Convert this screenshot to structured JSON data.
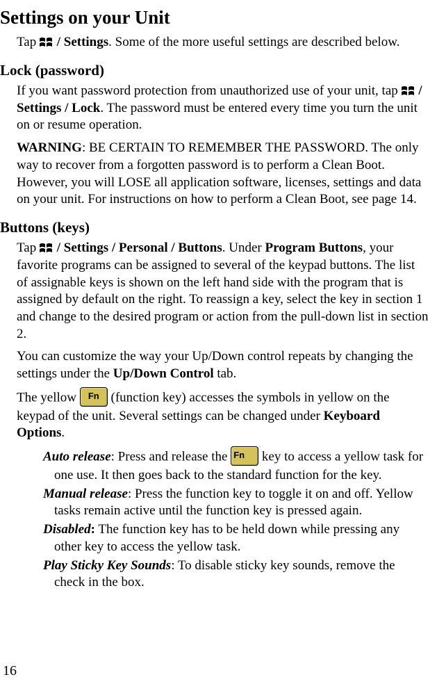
{
  "title": "Settings on your Unit",
  "intro": {
    "tap": "Tap ",
    "settings_path": " / Settings",
    "rest": ". Some of the more useful settings are described below."
  },
  "lock": {
    "heading": "Lock (password)",
    "para1_a": "If you want password protection from unauthorized use of your unit, tap ",
    "para1_path": " / Settings / Lock",
    "para1_b": ". The password must be entered every time you turn the unit on or resume operation.",
    "warning_label": "WARNING",
    "warning_text": ": BE CERTAIN TO REMEMBER THE PASSWORD. The only way to recover from a forgotten password is to perform a Clean Boot. However, you will LOSE all application software, licenses, settings and data on your unit. For instructions on how to perform a Clean Boot, see page 14."
  },
  "buttons": {
    "heading": "Buttons (keys)",
    "para1_a": "Tap ",
    "para1_path": " / Settings / Personal / Buttons",
    "para1_b": ". Under ",
    "para1_c": "Program Buttons",
    "para1_d": ", your favorite programs can be assigned to several of the keypad buttons. The list of assignable keys is shown on the left hand side with the program that is assigned by default on the right. To reassign a key, select the key in section 1 and change to the desired program or action from the pull-down list in section 2.",
    "para2_a": "You can customize the way your Up/Down control repeats by changing the settings under the ",
    "para2_b": "Up/Down Control",
    "para2_c": " tab.",
    "para3_a": "The yellow ",
    "para3_b": " (function key) accesses the symbols in yellow on the keypad of the unit. Several settings can be changed under ",
    "para3_c": "Keyboard Options",
    "para3_d": ".",
    "options": {
      "auto": {
        "label": "Auto release",
        "text_a": ": Press and release the ",
        "text_b": " key to access a yellow task for one use. It then goes back to the standard function for the key."
      },
      "manual": {
        "label": "Manual release",
        "text": ": Press the function key to toggle it on and off. Yellow tasks remain active until the function key is pressed again."
      },
      "disabled": {
        "label": "Disabled",
        "text": " The function key has to be held down while pressing any other key to access the yellow task."
      },
      "sticky": {
        "label": "Play Sticky Key Sounds",
        "text": ": To disable sticky key sounds, remove the check in the box."
      }
    }
  },
  "fn_label": "Fn",
  "page_number": "16"
}
